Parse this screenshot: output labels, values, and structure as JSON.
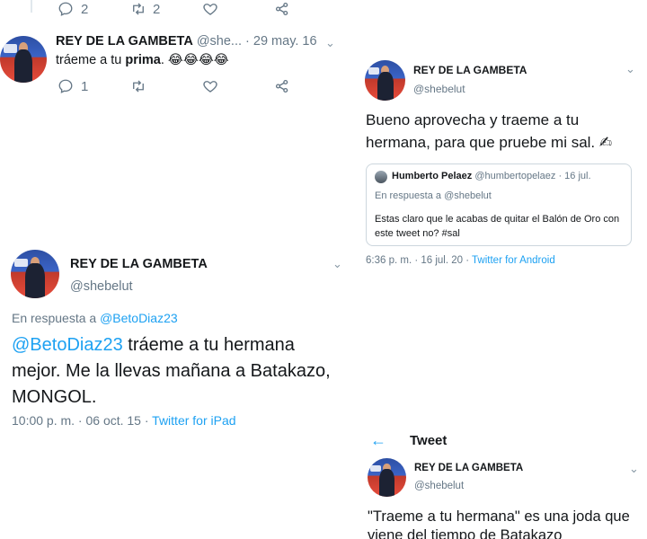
{
  "tweet_top_remnant": {
    "reply_count": "2",
    "retweet_count": "2"
  },
  "tweet_prima": {
    "display_name": "REY DE LA GAMBETA",
    "handle": "@she...",
    "date": "· 29 may. 16",
    "text_before": "tráeme a tu ",
    "text_bold": "prima",
    "text_after": ". 😂😂😂😂",
    "reply_count": "1"
  },
  "tweet_sal": {
    "display_name": "REY DE LA GAMBETA",
    "handle": "@shebelut",
    "text": "Bueno aprovecha y traeme a tu hermana, para que pruebe mi sal. ✍",
    "quoted": {
      "display_name": "Humberto Pelaez",
      "handle": "@humbertopelaez",
      "date": "· 16 jul.",
      "reply_prefix": "En respuesta a",
      "reply_to": "@shebelut",
      "text": "Estas claro que le acabas de quitar el Balón de Oro con este tweet no? #sal"
    },
    "timestamp": "6:36 p. m. · 16 jul. 20 · ",
    "source": "Twitter for Android"
  },
  "tweet_mongol": {
    "display_name": "REY DE LA GAMBETA",
    "handle": "@shebelut",
    "reply_prefix": "En respuesta a ",
    "reply_to": "@BetoDiaz23",
    "mention": "@BetoDiaz23",
    "text": " tráeme a tu hermana mejor. Me la llevas mañana a Batakazo, MONGOL.",
    "timestamp": "10:00 p. m. · 06 oct. 15 · ",
    "source": "Twitter for iPad"
  },
  "tweet_header": {
    "title": "Tweet"
  },
  "tweet_joda": {
    "display_name": "REY DE LA GAMBETA",
    "handle": "@shebelut",
    "text": "\"Traeme a tu hermana\" es una joda que viene del tiempo de Batakazo"
  },
  "colors": {
    "accent": "#1da1f2",
    "muted": "#657786",
    "text": "#14171a"
  }
}
